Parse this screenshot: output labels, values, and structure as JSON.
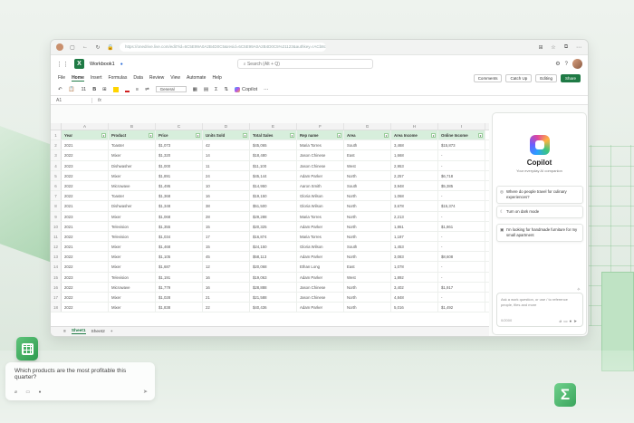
{
  "browser": {
    "url": "https://onedrive.live.com/edit?id=6C5E99A0A2B4D0C5&resid=6C5E99A0A2B4D0C5%21123&authkey=!ACb8cdef"
  },
  "app": {
    "workbook_title": "Workbook1",
    "search_placeholder": "Search (Alt + Q)",
    "menu_tabs": [
      "File",
      "Home",
      "Insert",
      "Formulas",
      "Data",
      "Review",
      "View",
      "Automate",
      "Help"
    ],
    "active_tab": "Home",
    "comments_label": "Comments",
    "catchup_label": "Catch Up",
    "editing_label": "Editing",
    "share_label": "Share"
  },
  "ribbon": {
    "font_size": "11",
    "number_format": "General",
    "copilot_label": "Copilot"
  },
  "formula": {
    "cell_ref": "A1",
    "fx": "fx"
  },
  "sheet": {
    "columns": [
      "A",
      "B",
      "C",
      "D",
      "E",
      "F",
      "G",
      "H",
      "I"
    ],
    "headers": [
      "Year",
      "Product",
      "Price",
      "Units Sold",
      "Total Sales",
      "Rep name",
      "Area",
      "Area Income",
      "Online Income"
    ],
    "rows": [
      [
        "2021",
        "Toaster",
        "$1,073",
        "42",
        "$45,065",
        "Maria Torres",
        "South",
        "3,468",
        "$15,873"
      ],
      [
        "2022",
        "Mixer",
        "$1,320",
        "14",
        "$18,480",
        "Jason Chinese",
        "East",
        "1,668",
        "-"
      ],
      [
        "2023",
        "Dishwasher",
        "$1,000",
        "11",
        "$11,100",
        "Jason Chinese",
        "West",
        "2,953",
        "-"
      ],
      [
        "2022",
        "Mixer",
        "$1,891",
        "24",
        "$45,144",
        "Adam Parker",
        "North",
        "2,257",
        "$6,718"
      ],
      [
        "2022",
        "Microwave",
        "$1,495",
        "10",
        "$14,950",
        "Aaron Smith",
        "South",
        "3,948",
        "$5,385"
      ],
      [
        "2022",
        "Toaster",
        "$1,368",
        "16",
        "$19,150",
        "Gloria Wilson",
        "North",
        "1,068",
        "-"
      ],
      [
        "2021",
        "Dishwasher",
        "$1,348",
        "38",
        "$51,500",
        "Gloria Wilson",
        "North",
        "3,678",
        "$15,374"
      ],
      [
        "2023",
        "Mixer",
        "$1,068",
        "28",
        "$29,288",
        "Maria Torres",
        "North",
        "2,213",
        "-"
      ],
      [
        "2021",
        "Television",
        "$1,355",
        "15",
        "$20,325",
        "Adam Parker",
        "North",
        "1,861",
        "$1,861"
      ],
      [
        "2022",
        "Television",
        "$1,034",
        "17",
        "$16,874",
        "Maria Torres",
        "North",
        "1,187",
        "-"
      ],
      [
        "2021",
        "Mixer",
        "$1,468",
        "15",
        "$24,150",
        "Gloria Wilson",
        "South",
        "1,453",
        "-"
      ],
      [
        "2022",
        "Mixer",
        "$1,105",
        "45",
        "$58,113",
        "Adam Parker",
        "North",
        "3,083",
        "$8,608"
      ],
      [
        "2022",
        "Mixer",
        "$1,687",
        "12",
        "$20,068",
        "Ethan Long",
        "East",
        "1,078",
        "-"
      ],
      [
        "2023",
        "Television",
        "$1,191",
        "16",
        "$19,063",
        "Adam Parker",
        "West",
        "1,892",
        "-"
      ],
      [
        "2022",
        "Microwave",
        "$1,779",
        "16",
        "$28,888",
        "Jason Chinese",
        "North",
        "3,402",
        "$1,917"
      ],
      [
        "2022",
        "Mixer",
        "$1,028",
        "21",
        "$21,588",
        "Jason Chinese",
        "North",
        "4,848",
        "-"
      ],
      [
        "2022",
        "Mixer",
        "$1,838",
        "22",
        "$40,436",
        "Adam Parker",
        "North",
        "5,016",
        "$1,492"
      ]
    ],
    "tabs": [
      "Sheet1",
      "Sheet2"
    ],
    "add_tab": "+"
  },
  "copilot": {
    "title": "Copilot",
    "subtitle": "Your everyday AI companion",
    "suggestions": [
      "Where do people travel for culinary experiences?",
      "Turn on dark mode",
      "I'm looking for handmade furniture for my small apartment"
    ],
    "input_placeholder": "Ask a work question, or use / to reference people, files and more",
    "char_count": "0/2000"
  },
  "overlay": {
    "question": "Which products are the most profitable this quarter?"
  },
  "colors": {
    "excel_green": "#1f7a45",
    "header_fill": "#d7eedc"
  }
}
